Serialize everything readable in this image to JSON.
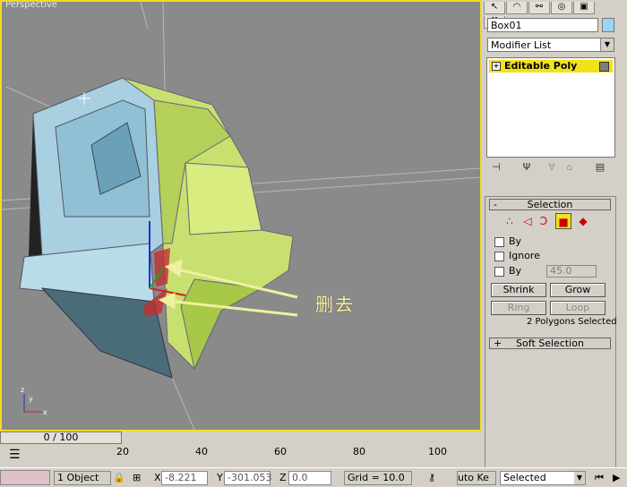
{
  "viewport": {
    "label": "Perspective",
    "annotation": "删去",
    "axis_labels": {
      "z": "z",
      "x": "x",
      "y": "y"
    }
  },
  "command_panel": {
    "tab_icons": [
      "select-arrow-icon",
      "curve-icon",
      "hierarchy-icon",
      "motion-icon",
      "display-icon",
      "utilities-icon"
    ],
    "object_name": "Box01",
    "object_color": "#9ad6f2",
    "modifier_list": "Modifier List",
    "stack": {
      "item": "Editable Poly",
      "highlight": "#f2e21c"
    },
    "stack_tools": [
      "pin-stack-icon",
      "show-end-result-icon",
      "make-unique-icon",
      "remove-modifier-icon",
      "configure-sets-icon"
    ]
  },
  "selection_rollout": {
    "title": "Selection",
    "collapse_sign": "-",
    "by_vertex_label": "By",
    "ignore_backfacing_label": "Ignore",
    "by_angle_label": "By",
    "angle_value": "45.0",
    "shrink_label": "Shrink",
    "grow_label": "Grow",
    "ring_label": "Ring",
    "loop_label": "Loop",
    "status": "2 Polygons Selected"
  },
  "soft_selection_rollout": {
    "title": "Soft Selection",
    "expand_sign": "+"
  },
  "timeline": {
    "slider_text": "0 / 100",
    "ruler": [
      "20",
      "40",
      "60",
      "80",
      "100"
    ]
  },
  "statusbar": {
    "object_count": "1 Object",
    "x_label": "X",
    "x_value": "-8.221",
    "y_label": "Y",
    "y_value": "-301.053",
    "z_label": "Z",
    "z_value": "0.0",
    "grid": "Grid = 10.0",
    "auto_key": "uto Ke",
    "key_filter": "Selected"
  }
}
